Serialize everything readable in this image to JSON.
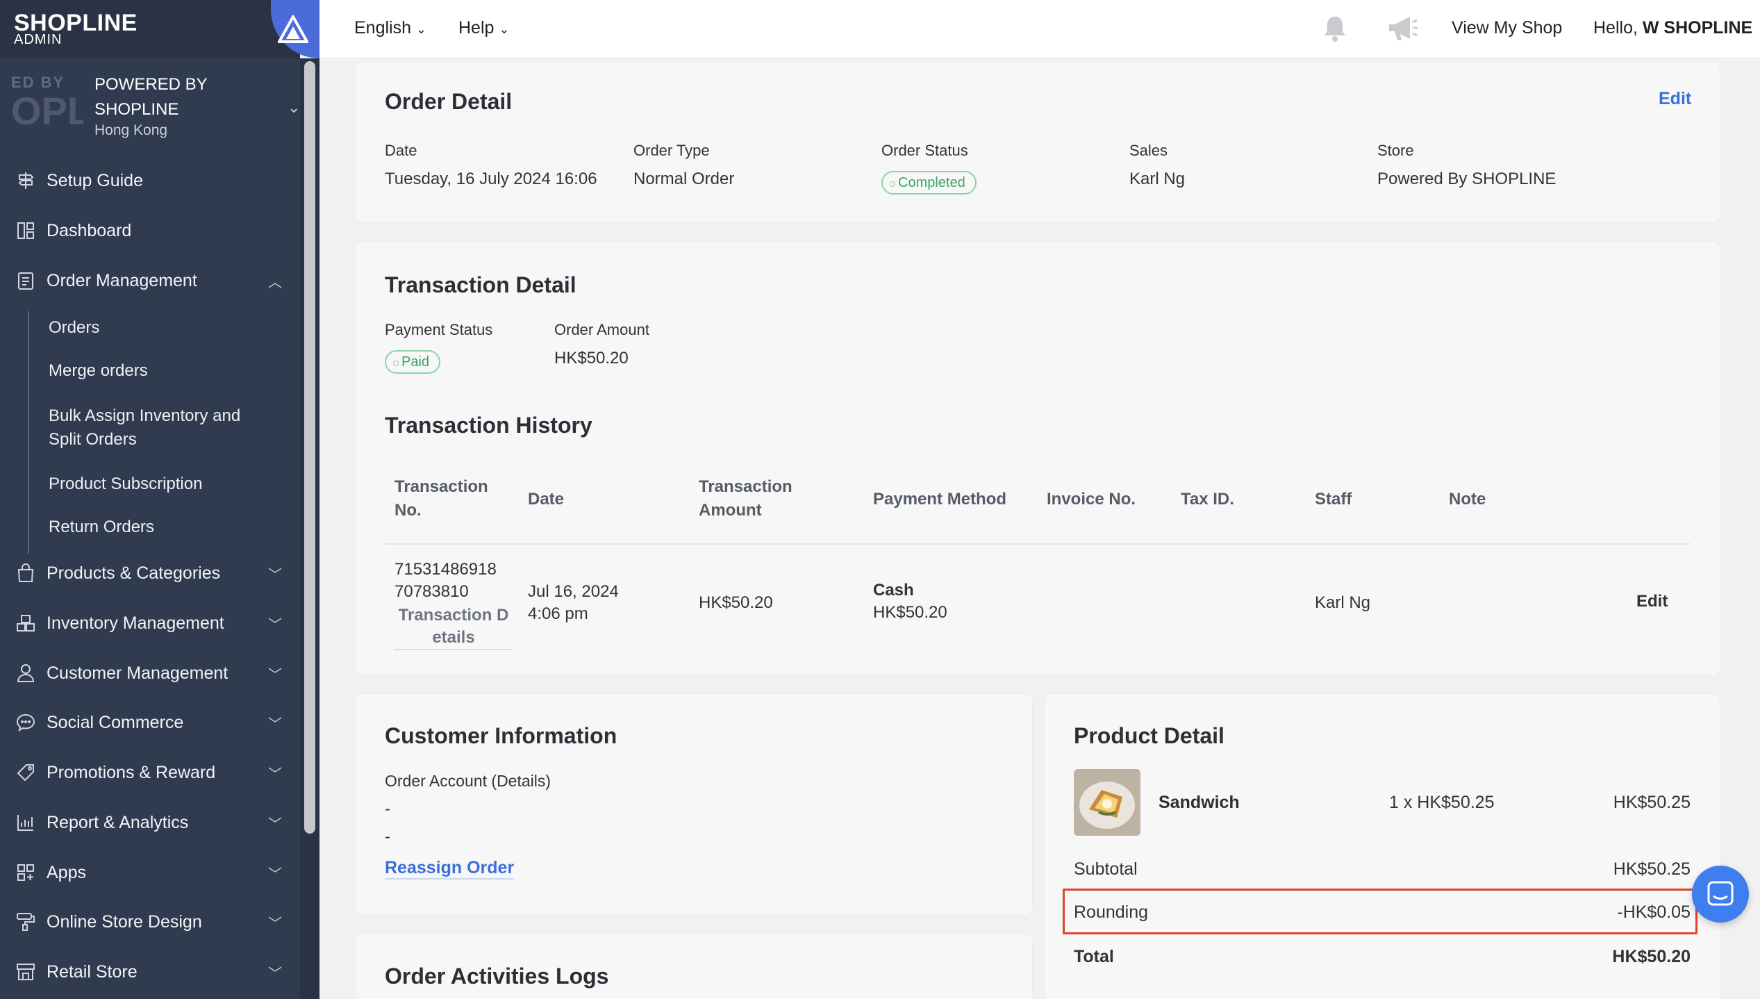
{
  "brand": {
    "logo": "SHOPLINE",
    "logo_sub": "ADMIN"
  },
  "store": {
    "thumb_top": "ED BY",
    "thumb_big": "OPL",
    "name_line1": "POWERED BY",
    "name_line2": "SHOPLINE",
    "region": "Hong Kong"
  },
  "nav": {
    "items": [
      {
        "label": "Setup Guide",
        "icon": "signpost-icon"
      },
      {
        "label": "Dashboard",
        "icon": "dashboard-icon"
      },
      {
        "label": "Order Management",
        "icon": "clipboard-icon"
      },
      {
        "label": "Products & Categories",
        "icon": "bag-icon"
      },
      {
        "label": "Inventory Management",
        "icon": "boxes-icon"
      },
      {
        "label": "Customer Management",
        "icon": "person-icon"
      },
      {
        "label": "Social Commerce",
        "icon": "chat-icon"
      },
      {
        "label": "Promotions & Reward",
        "icon": "tag-icon"
      },
      {
        "label": "Report & Analytics",
        "icon": "bar-chart-icon"
      },
      {
        "label": "Apps",
        "icon": "apps-grid-icon"
      },
      {
        "label": "Online Store Design",
        "icon": "paint-roller-icon"
      },
      {
        "label": "Retail Store",
        "icon": "store-icon"
      }
    ],
    "order_sub": [
      "Orders",
      "Merge orders",
      "Bulk Assign Inventory and",
      "Split Orders",
      "Product Subscription",
      "Return Orders"
    ]
  },
  "topbar": {
    "language": "English",
    "help": "Help",
    "view_shop": "View My Shop",
    "greeting": "Hello,",
    "user": "W SHOPLINE"
  },
  "order_detail": {
    "title": "Order Detail",
    "edit": "Edit",
    "fields": [
      {
        "label": "Date",
        "value": "Tuesday, 16 July 2024 16:06"
      },
      {
        "label": "Order Type",
        "value": "Normal Order"
      },
      {
        "label": "Order Status",
        "value": "Completed"
      },
      {
        "label": "Sales",
        "value": "Karl Ng"
      },
      {
        "label": "Store",
        "value": "Powered By SHOPLINE"
      }
    ]
  },
  "transaction": {
    "title": "Transaction Detail",
    "payment_status_label": "Payment Status",
    "payment_status": "Paid",
    "order_amount_label": "Order Amount",
    "order_amount": "HK$50.20",
    "history_title": "Transaction History",
    "headers": {
      "no_1": "Transaction",
      "no_2": "No.",
      "date": "Date",
      "amount_1": "Transaction",
      "amount_2": "Amount",
      "method": "Payment Method",
      "invoice": "Invoice No.",
      "tax": "Tax ID.",
      "staff": "Staff",
      "note": "Note"
    },
    "row": {
      "no_1": "71531486918",
      "no_2": "70783810",
      "details_1": "Transaction D",
      "details_2": "etails",
      "date_1": "Jul 16, 2024",
      "date_2": "4:06 pm",
      "amount": "HK$50.20",
      "method": "Cash",
      "method_amount": "HK$50.20",
      "staff": "Karl Ng",
      "edit": "Edit"
    }
  },
  "customer": {
    "title": "Customer Information",
    "account_label": "Order Account (Details)",
    "line1": "-",
    "line2": "-",
    "reassign": "Reassign Order"
  },
  "logs": {
    "title": "Order Activities Logs"
  },
  "product": {
    "title": "Product Detail",
    "item_name": "Sandwich",
    "qty_price": "1 x HK$50.25",
    "item_total": "HK$50.25",
    "subtotal_label": "Subtotal",
    "subtotal": "HK$50.25",
    "rounding_label": "Rounding",
    "rounding": "-HK$0.05",
    "total_label": "Total",
    "total": "HK$50.20"
  },
  "colors": {
    "sidebar": "#313b4f",
    "accent": "#3a6fd8",
    "success": "#3aa466",
    "highlight": "#e0452b"
  }
}
